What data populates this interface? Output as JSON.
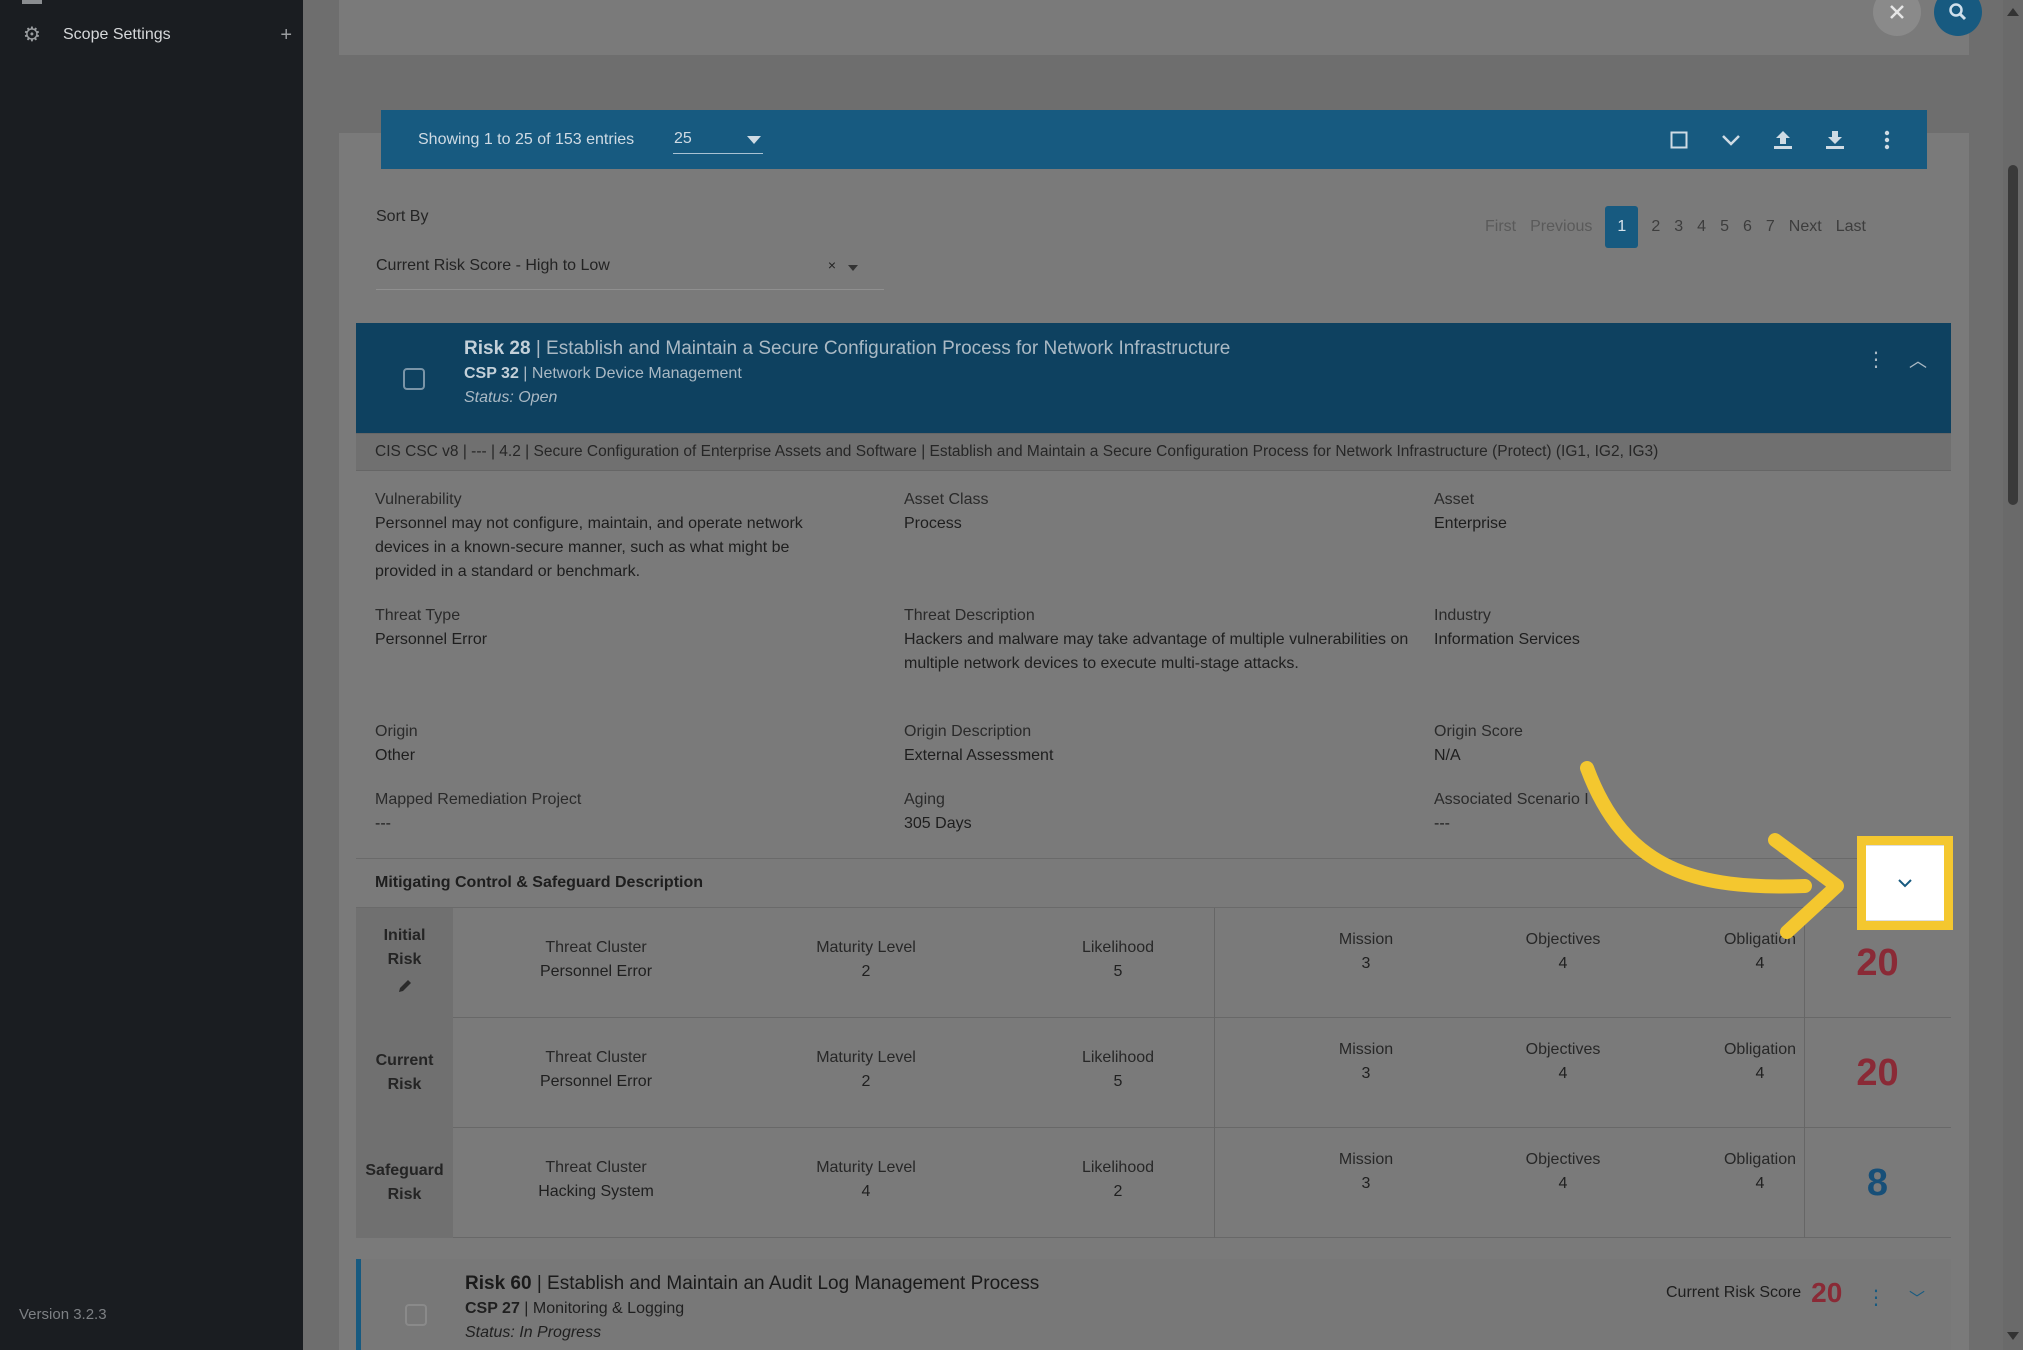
{
  "sidebar": {
    "scope_settings_label": "Scope Settings",
    "plus_glyph": "+",
    "gear_icon": "gear-icon",
    "version": "Version 3.2.3"
  },
  "toolbar": {
    "showing": "Showing 1 to 25 of 153 entries",
    "per_page": "25"
  },
  "sort": {
    "label": "Sort By",
    "value": "Current Risk Score - High to Low",
    "clear": "×"
  },
  "pagination": {
    "first": "First",
    "previous": "Previous",
    "pages": [
      "1",
      "2",
      "3",
      "4",
      "5",
      "6",
      "7"
    ],
    "next": "Next",
    "last": "Last"
  },
  "risk": {
    "id": "Risk 28",
    "title": "Establish and Maintain a Secure Configuration Process for Network Infrastructure",
    "csp_id": "CSP 32",
    "csp_name": "Network Device Management",
    "status": "Status: Open",
    "cis_line": "CIS CSC v8 | --- | 4.2 | Secure Configuration of Enterprise Assets and Software | Establish and Maintain a Secure Configuration Process for Network Infrastructure (Protect) (IG1, IG2, IG3)",
    "fields": {
      "vulnerability_label": "Vulnerability",
      "vulnerability": "Personnel may not configure, maintain, and operate network devices in a known-secure manner, such as what might be provided in a standard or benchmark.",
      "asset_class_label": "Asset Class",
      "asset_class": "Process",
      "asset_label": "Asset",
      "asset": "Enterprise",
      "threat_type_label": "Threat Type",
      "threat_type": "Personnel Error",
      "threat_desc_label": "Threat Description",
      "threat_desc": "Hackers and malware may take advantage of multiple vulnerabilities on multiple network devices to execute multi-stage attacks.",
      "industry_label": "Industry",
      "industry": "Information Services",
      "origin_label": "Origin",
      "origin": "Other",
      "origin_desc_label": "Origin Description",
      "origin_desc": "External Assessment",
      "origin_score_label": "Origin Score",
      "origin_score": "N/A",
      "mapped_label": "Mapped Remediation Project",
      "mapped": "---",
      "aging_label": "Aging",
      "aging": "305 Days",
      "assoc_label": "Associated Scenario I",
      "assoc": "---"
    },
    "mitigating_label": "Mitigating Control & Safeguard Description",
    "rows": [
      {
        "label_line1": "Initial",
        "label_line2": "Risk",
        "threat_cluster": "Personnel Error",
        "maturity": "2",
        "likelihood": "5",
        "mission": "3",
        "objectives": "4",
        "obligation": "4",
        "score": "20"
      },
      {
        "label_line1": "Current",
        "label_line2": "Risk",
        "threat_cluster": "Personnel Error",
        "maturity": "2",
        "likelihood": "5",
        "mission": "3",
        "objectives": "4",
        "obligation": "4",
        "score": "20"
      },
      {
        "label_line1": "Safeguard",
        "label_line2": "Risk",
        "threat_cluster": "Hacking System",
        "maturity": "4",
        "likelihood": "2",
        "mission": "3",
        "objectives": "4",
        "obligation": "4",
        "score": "8"
      }
    ],
    "col_labels": {
      "threat_cluster": "Threat Cluster",
      "maturity": "Maturity Level",
      "likelihood": "Likelihood",
      "mission": "Mission",
      "objectives": "Objectives",
      "obligation": "Obligation"
    }
  },
  "risk2": {
    "id": "Risk 60",
    "title": "Establish and Maintain an Audit Log Management Process",
    "csp_id": "CSP 27",
    "csp_name": "Monitoring & Logging",
    "status": "Status: In Progress",
    "current_score_label": "Current Risk Score",
    "current_score": "20"
  },
  "colors": {
    "primary": "#175a80",
    "header": "#0e4160",
    "score_high": "#8a2a36",
    "score_low": "#174f78",
    "highlight": "#f4c72f"
  }
}
